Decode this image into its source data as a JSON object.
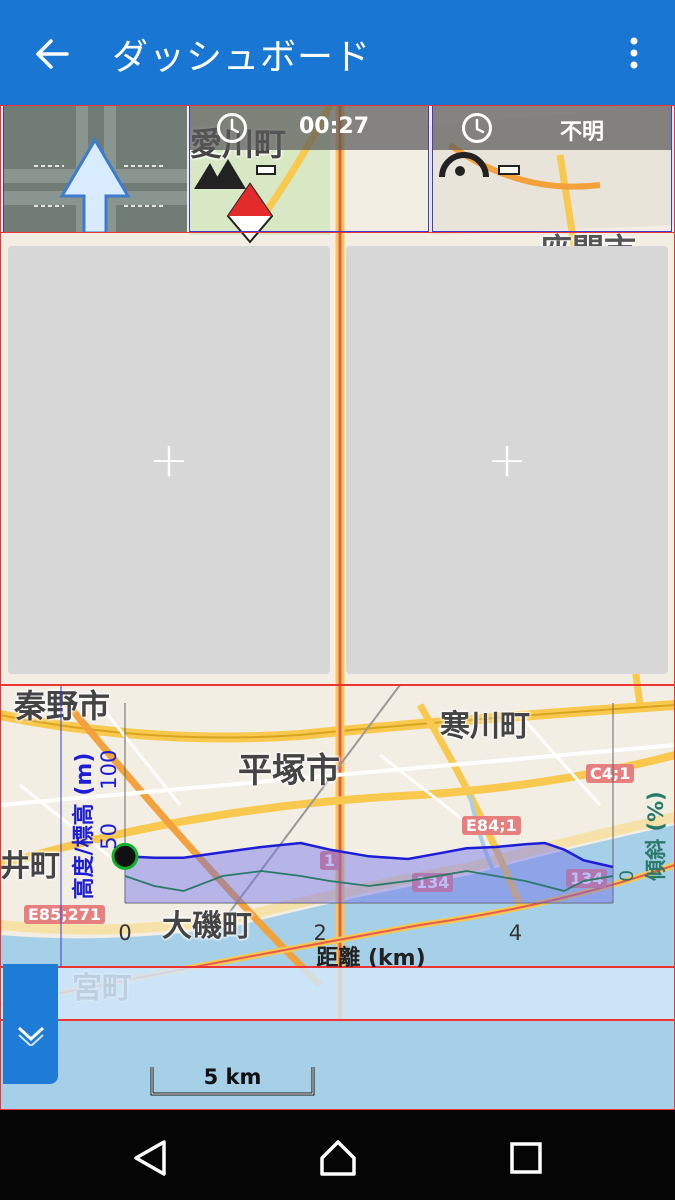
{
  "appbar": {
    "title": "ダッシュボード",
    "back_icon": "arrow-back-icon",
    "menu_icon": "more-vert-icon",
    "color": "#1976d2"
  },
  "widgets": {
    "navigation": {
      "icon": "straight-arrow-icon"
    },
    "time": {
      "value": "00:27",
      "icon": "clock-icon"
    },
    "eta": {
      "value": "不明",
      "icon": "clock-icon"
    }
  },
  "tiles": [
    {
      "icon": "plus-icon",
      "label": "+"
    },
    {
      "icon": "plus-icon",
      "label": "+"
    }
  ],
  "map_labels": {
    "aikawa": "愛川町",
    "hadano": "秦野市",
    "samukawa": "寒川町",
    "hiratsuka": "平塚市",
    "oiso": "大磯町",
    "ninomiya": "宮町",
    "imachi": "井町",
    "zama": "座間市"
  },
  "road_signs": [
    "C4;1",
    "E84;1",
    "E85;271",
    "1",
    "134",
    "134"
  ],
  "chart_data": {
    "type": "line",
    "xlabel": "距離 (km)",
    "ylabel_left": "高度/標高 (m)",
    "ylabel_right": "傾斜 (%)",
    "x_ticks": [
      "0",
      "2",
      "4"
    ],
    "y_ticks": [
      "50",
      "100"
    ],
    "right_ticks": [
      "0"
    ],
    "xlim": [
      0,
      5
    ],
    "ylim": [
      0,
      150
    ],
    "series": [
      {
        "name": "高度/標高 (m)",
        "color": "#1d1dd6",
        "x": [
          0,
          0.3,
          0.6,
          1.0,
          1.4,
          1.8,
          2.1,
          2.5,
          2.9,
          3.2,
          3.5,
          3.8,
          4.1,
          4.3,
          4.5,
          4.7,
          5.0
        ],
        "y": [
          35,
          34,
          34,
          38,
          42,
          45,
          40,
          35,
          33,
          37,
          41,
          42,
          44,
          45,
          40,
          32,
          27
        ]
      },
      {
        "name": "傾斜 (%)",
        "color": "#2a7a6a",
        "x": [
          0,
          0.3,
          0.6,
          1.0,
          1.4,
          1.8,
          2.1,
          2.5,
          2.9,
          3.2,
          3.5,
          3.8,
          4.1,
          4.3,
          4.5,
          4.7,
          5.0
        ],
        "y": [
          0,
          -2,
          -3,
          0,
          1,
          0,
          -1,
          -2,
          -1,
          0,
          1,
          0,
          -1,
          -2,
          -3,
          -1,
          0
        ]
      }
    ],
    "marker_color": "#0bb32a"
  },
  "scale": {
    "label": "5 km"
  },
  "navbar": {
    "back_icon": "nav-back-icon",
    "home_icon": "nav-home-icon",
    "recents_icon": "nav-recents-icon"
  },
  "collapse": {
    "icon": "chevron-down-icon"
  }
}
